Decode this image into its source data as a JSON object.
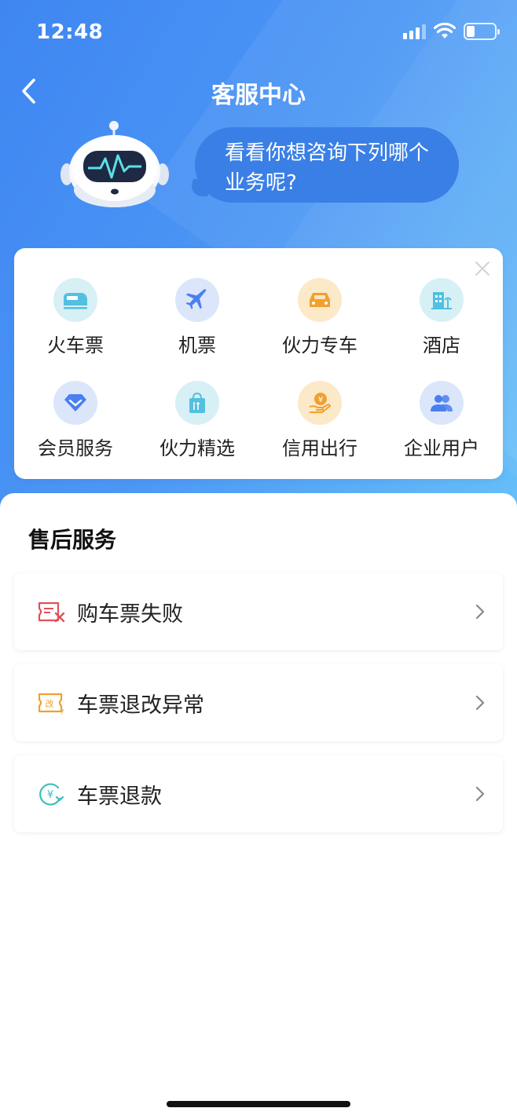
{
  "status_bar": {
    "time": "12:48"
  },
  "nav": {
    "title": "客服中心"
  },
  "assistant": {
    "greeting_line1": "看看你想咨询下列哪个",
    "greeting_line2": "业务呢?"
  },
  "categories": [
    {
      "label": "火车票",
      "icon": "train-icon",
      "color": "#52c0e0",
      "bg": "#d7f0f6"
    },
    {
      "label": "机票",
      "icon": "airplane-icon",
      "color": "#4a7ff0",
      "bg": "#dbe6fb"
    },
    {
      "label": "伙力专车",
      "icon": "car-icon",
      "color": "#f0a030",
      "bg": "#fbe9c8"
    },
    {
      "label": "酒店",
      "icon": "hotel-icon",
      "color": "#52c0e0",
      "bg": "#d7f0f6"
    },
    {
      "label": "会员服务",
      "icon": "diamond-icon",
      "color": "#4a7ff0",
      "bg": "#dbe6fb"
    },
    {
      "label": "伙力精选",
      "icon": "shopping-bag-icon",
      "color": "#52c0e0",
      "bg": "#d7f0f6"
    },
    {
      "label": "信用出行",
      "icon": "coin-hand-icon",
      "color": "#f0a030",
      "bg": "#fbe9c8"
    },
    {
      "label": "企业用户",
      "icon": "users-icon",
      "color": "#4a7ff0",
      "bg": "#dbe6fb"
    }
  ],
  "after_sales": {
    "title": "售后服务",
    "items": [
      {
        "label": "购车票失败",
        "icon": "ticket-fail-icon",
        "color": "#e0505a"
      },
      {
        "label": "车票退改异常",
        "icon": "ticket-change-icon",
        "color": "#f0a030"
      },
      {
        "label": "车票退款",
        "icon": "refund-icon",
        "color": "#3cc0b8"
      }
    ]
  },
  "theme": {
    "accent": "#3f86f2",
    "bubble": "#3a7fe6"
  }
}
